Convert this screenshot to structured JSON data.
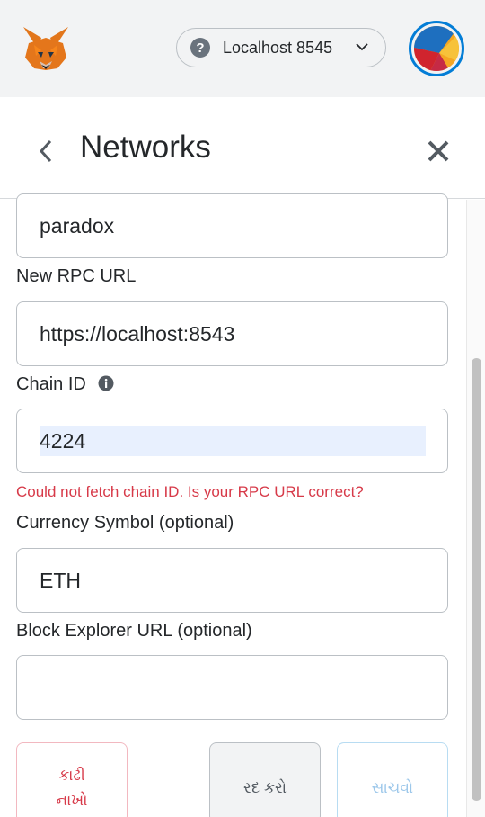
{
  "app": {
    "network_selector": {
      "label": "Localhost 8545"
    }
  },
  "page": {
    "title": "Networks"
  },
  "form": {
    "network_name_value": "paradox",
    "rpc_url_label": "New RPC URL",
    "rpc_url_value": "https://localhost:8543",
    "chain_id_label": "Chain ID",
    "chain_id_value": "4224",
    "chain_id_error": "Could not fetch chain ID. Is your RPC URL correct?",
    "currency_symbol_label": "Currency Symbol (optional)",
    "currency_symbol_value": "ETH",
    "block_explorer_label": "Block Explorer URL (optional)",
    "block_explorer_value": ""
  },
  "buttons": {
    "delete_line1": "કાઢી",
    "delete_line2": "નાખો",
    "cancel": "રદ કરો",
    "save": "સાચવો"
  },
  "colors": {
    "accent": "#037dd6",
    "error": "#d73a49",
    "topbar_bg": "#f2f3f4"
  },
  "icons": [
    "metamask-fox-logo",
    "help-circle-icon",
    "chevron-down-icon",
    "account-identicon",
    "back-arrow-icon",
    "close-icon",
    "info-icon"
  ]
}
